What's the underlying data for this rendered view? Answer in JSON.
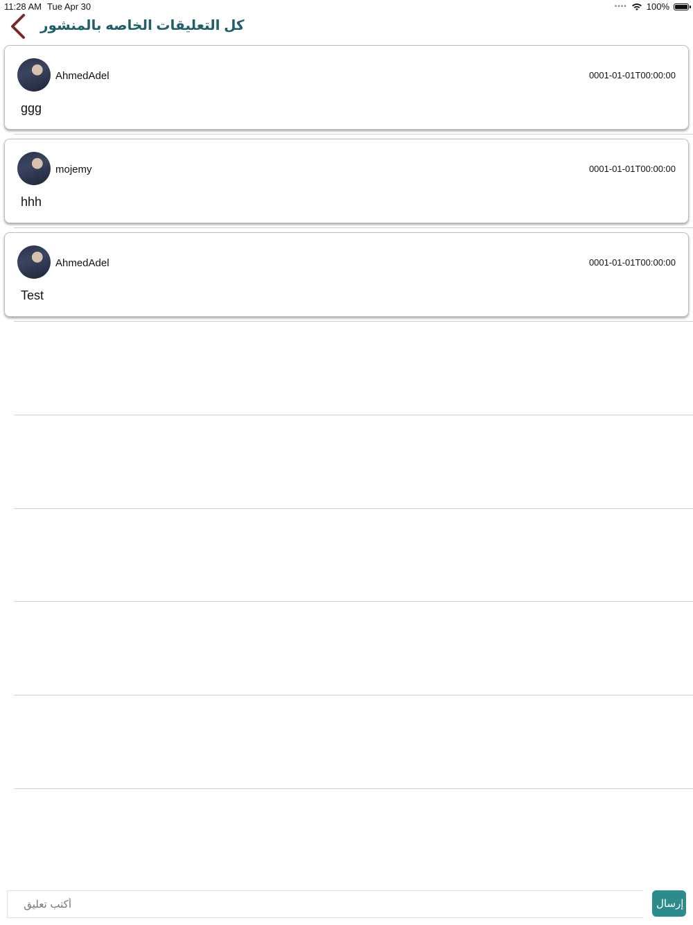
{
  "status_bar": {
    "time": "11:28 AM",
    "date": "Tue Apr 30",
    "battery": "100%"
  },
  "header": {
    "title": "كل التعليقات الخاصه بالمنشور",
    "back_icon": "chevron-left-icon",
    "title_color": "#1e5f6a",
    "back_color": "#7a2a2a"
  },
  "comments": [
    {
      "username": "AhmedAdel",
      "timestamp": "0001-01-01T00:00:00",
      "text": "ggg"
    },
    {
      "username": "mojemy",
      "timestamp": "0001-01-01T00:00:00",
      "text": "hhh"
    },
    {
      "username": "AhmedAdel",
      "timestamp": "0001-01-01T00:00:00",
      "text": "Test"
    }
  ],
  "composer": {
    "placeholder": "أكتب تعليق",
    "send_label": "إرسال",
    "send_color": "#2e8b8b"
  }
}
